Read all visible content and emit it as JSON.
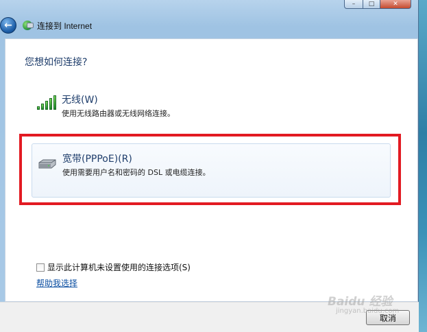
{
  "window": {
    "title": "连接到 Internet",
    "min_glyph": "–",
    "max_glyph": "□",
    "close_glyph": "✕",
    "back_glyph": "←"
  },
  "content": {
    "question": "您想如何连接?",
    "options": [
      {
        "title": "无线(W)",
        "description": "使用无线路由器或无线网络连接。",
        "icon": "wireless-signal-icon"
      },
      {
        "title": "宽带(PPPoE)(R)",
        "description": "使用需要用户名和密码的 DSL 或电缆连接。",
        "icon": "broadband-modem-icon"
      }
    ],
    "highlight_color": "#e21a22",
    "checkbox_label": "显示此计算机未设置使用的连接选项(S)",
    "checkbox_checked": false,
    "help_link": "帮助我选择"
  },
  "footer": {
    "cancel_label": "取消"
  },
  "watermark": {
    "text": "Baidu 经验",
    "subtext": "jingyan.baidu.com"
  }
}
